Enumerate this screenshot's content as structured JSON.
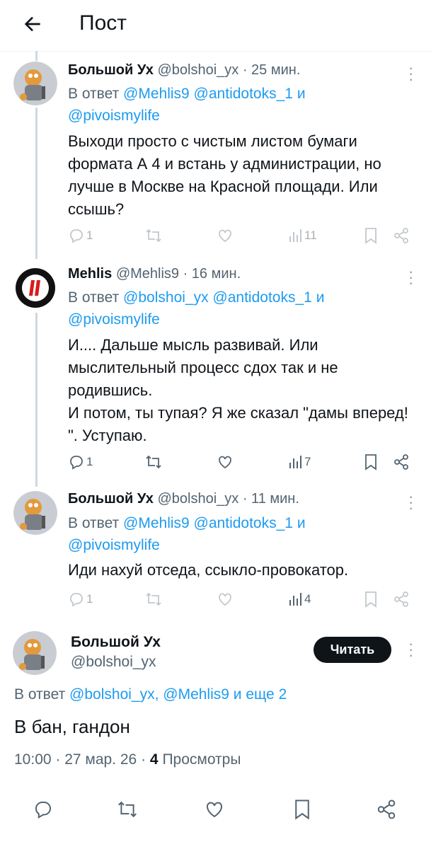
{
  "header": {
    "title": "Пост"
  },
  "tweets": [
    {
      "name": "Большой Ух",
      "handle": "@bolshoi_yx",
      "time": "· 25 мин.",
      "reply_prefix": "В ответ",
      "reply_mentions_1": "@Mehlis9 @antidotoks_1",
      "reply_and": "и",
      "reply_mentions_2": "@pivoismylife",
      "text": "Выходи просто с чистым листом бумаги формата А 4  и встань у администрации, но лучше в Москве на Красной площади. Или ссышь?",
      "replies": "1",
      "views": "11"
    },
    {
      "name": "Mehlis",
      "handle": "@Mehlis9",
      "time": "· 16 мин.",
      "reply_prefix": "В ответ",
      "reply_mentions_1": "@bolshoi_yx @antidotoks_1",
      "reply_and": "и",
      "reply_mentions_2": "@pivoismylife",
      "text": "И.... Дальше мысль развивай. Или мыслительный процесс сдох так и не родившись.\nИ потом, ты тупая? Я же сказал \"дамы вперед! \". Уступаю.",
      "replies": "1",
      "views": "7"
    },
    {
      "name": "Большой Ух",
      "handle": "@bolshoi_yx",
      "time": "· 11 мин.",
      "reply_prefix": "В ответ",
      "reply_mentions_1": "@Mehlis9 @antidotoks_1",
      "reply_and": "и",
      "reply_mentions_2": "@pivoismylife",
      "text": "Иди нахуй отседа, ссыкло-провокатор.",
      "replies": "1",
      "views": "4"
    }
  ],
  "main": {
    "name": "Большой Ух",
    "handle": "@bolshoi_yx",
    "read_button": "Читать",
    "reply_prefix": "В ответ",
    "reply_mentions": "@bolshoi_yx, @Mehlis9 и еще 2",
    "text": "В бан, гандон",
    "meta_time": "10:00 · 27 мар. 26 ·",
    "views_count": "4",
    "views_label": "Просмотры"
  },
  "colors": {
    "link": "#1d9bf0",
    "muted": "#536471",
    "text": "#0f1419"
  },
  "icons": [
    "back-arrow-icon",
    "more-icon",
    "reply-icon",
    "retweet-icon",
    "like-icon",
    "views-icon",
    "bookmark-icon",
    "share-icon"
  ]
}
